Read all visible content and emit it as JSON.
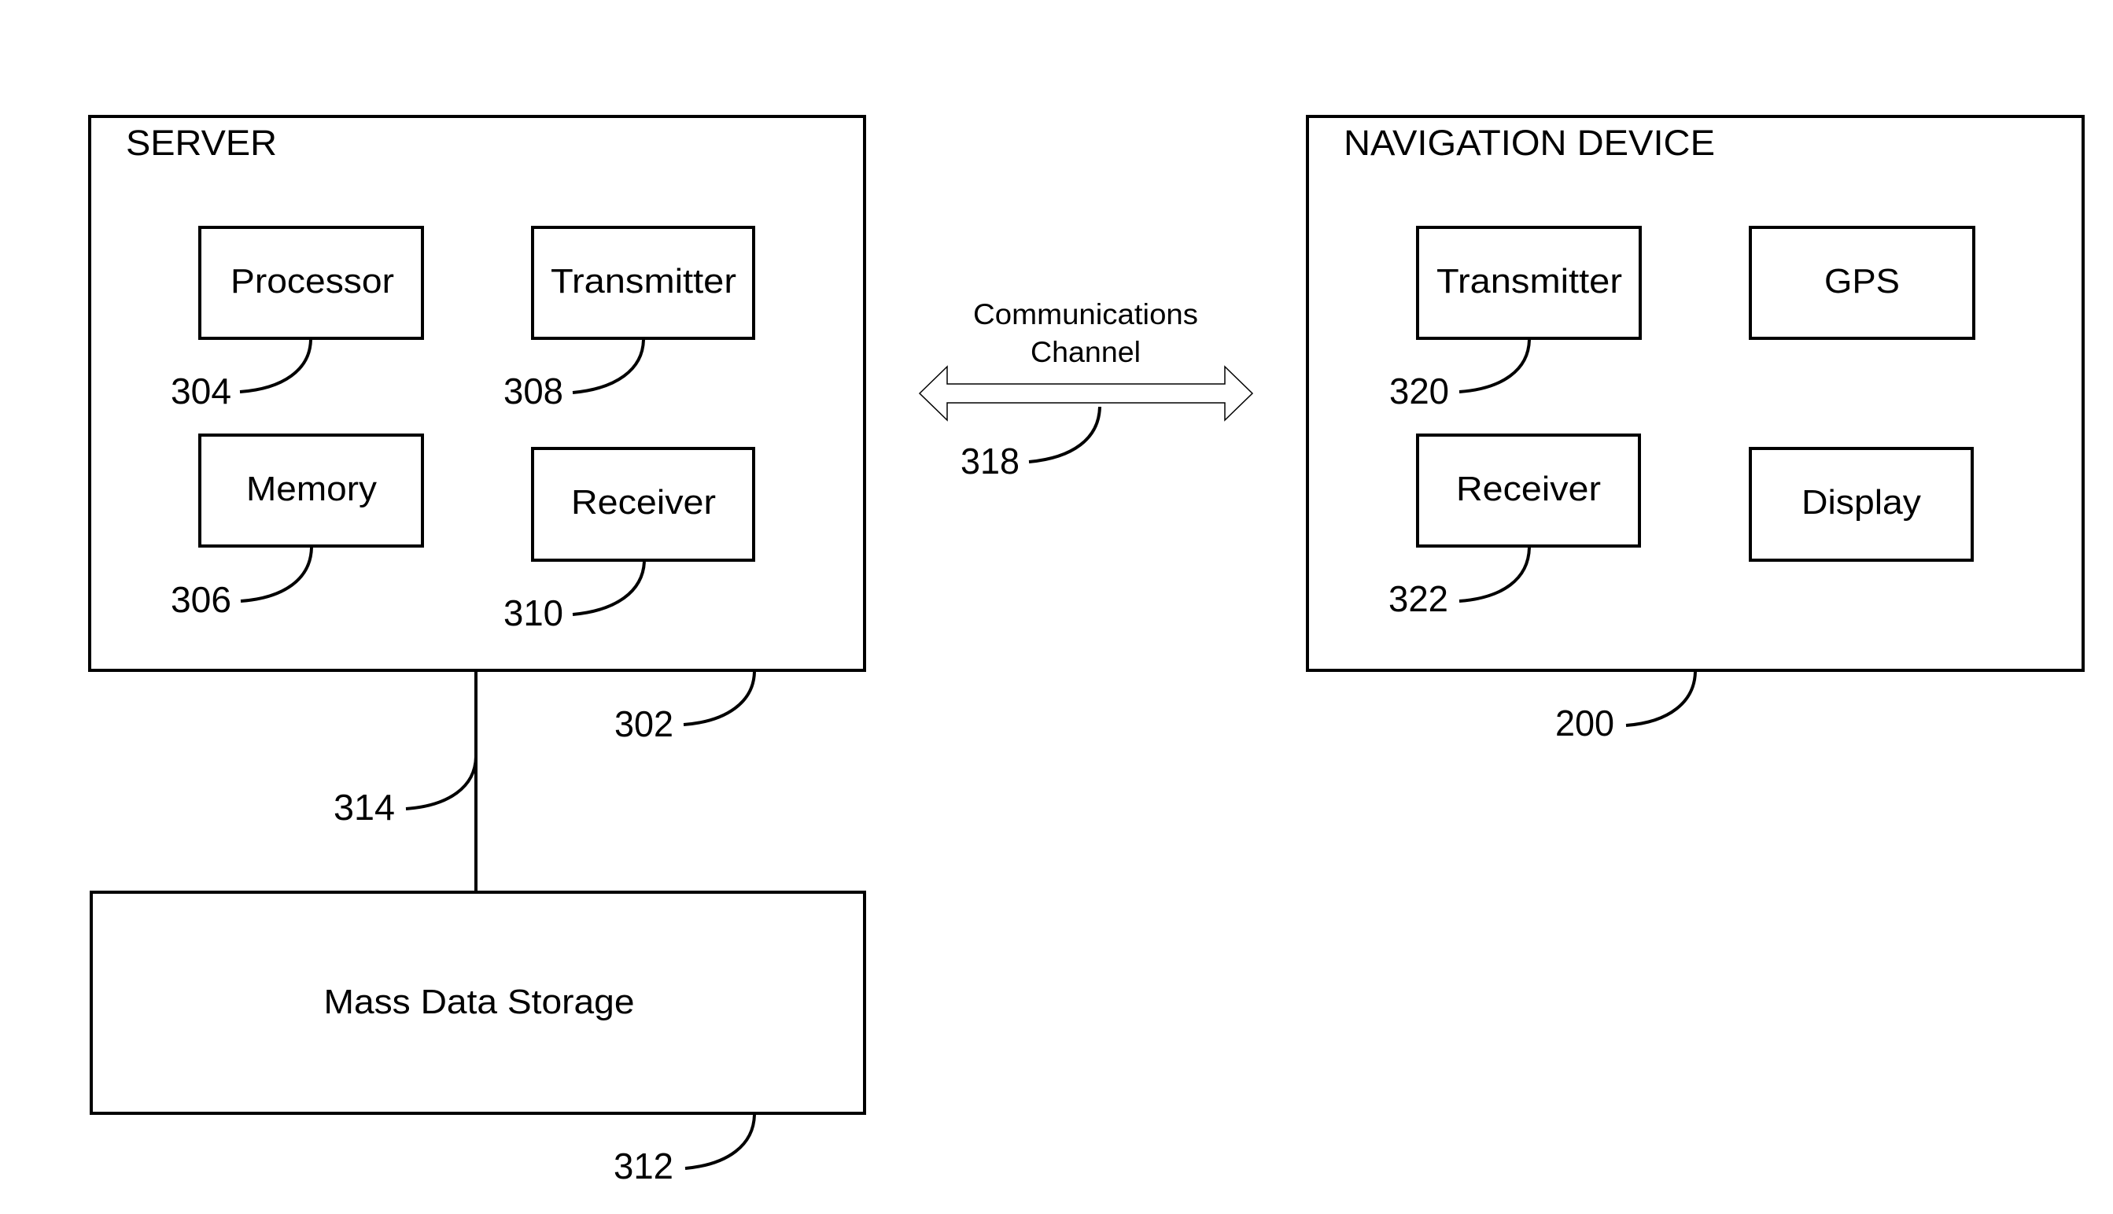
{
  "diagram": {
    "server": {
      "title": "SERVER",
      "ref": "302",
      "components": {
        "processor": {
          "label": "Processor",
          "ref": "304"
        },
        "memory": {
          "label": "Memory",
          "ref": "306"
        },
        "transmitter": {
          "label": "Transmitter",
          "ref": "308"
        },
        "receiver": {
          "label": "Receiver",
          "ref": "310"
        }
      }
    },
    "mass_storage": {
      "label": "Mass Data Storage",
      "ref": "312"
    },
    "server_storage_link": {
      "ref": "314"
    },
    "channel": {
      "label_line1": "Communications",
      "label_line2": "Channel",
      "ref": "318",
      "direction": "bidirectional"
    },
    "navigation_device": {
      "title": "NAVIGATION DEVICE",
      "ref": "200",
      "components": {
        "transmitter": {
          "label": "Transmitter",
          "ref": "320"
        },
        "receiver": {
          "label": "Receiver",
          "ref": "322"
        },
        "gps": {
          "label": "GPS"
        },
        "display": {
          "label": "Display"
        }
      }
    },
    "colors": {
      "stroke": "#000000",
      "background": "#ffffff"
    }
  }
}
